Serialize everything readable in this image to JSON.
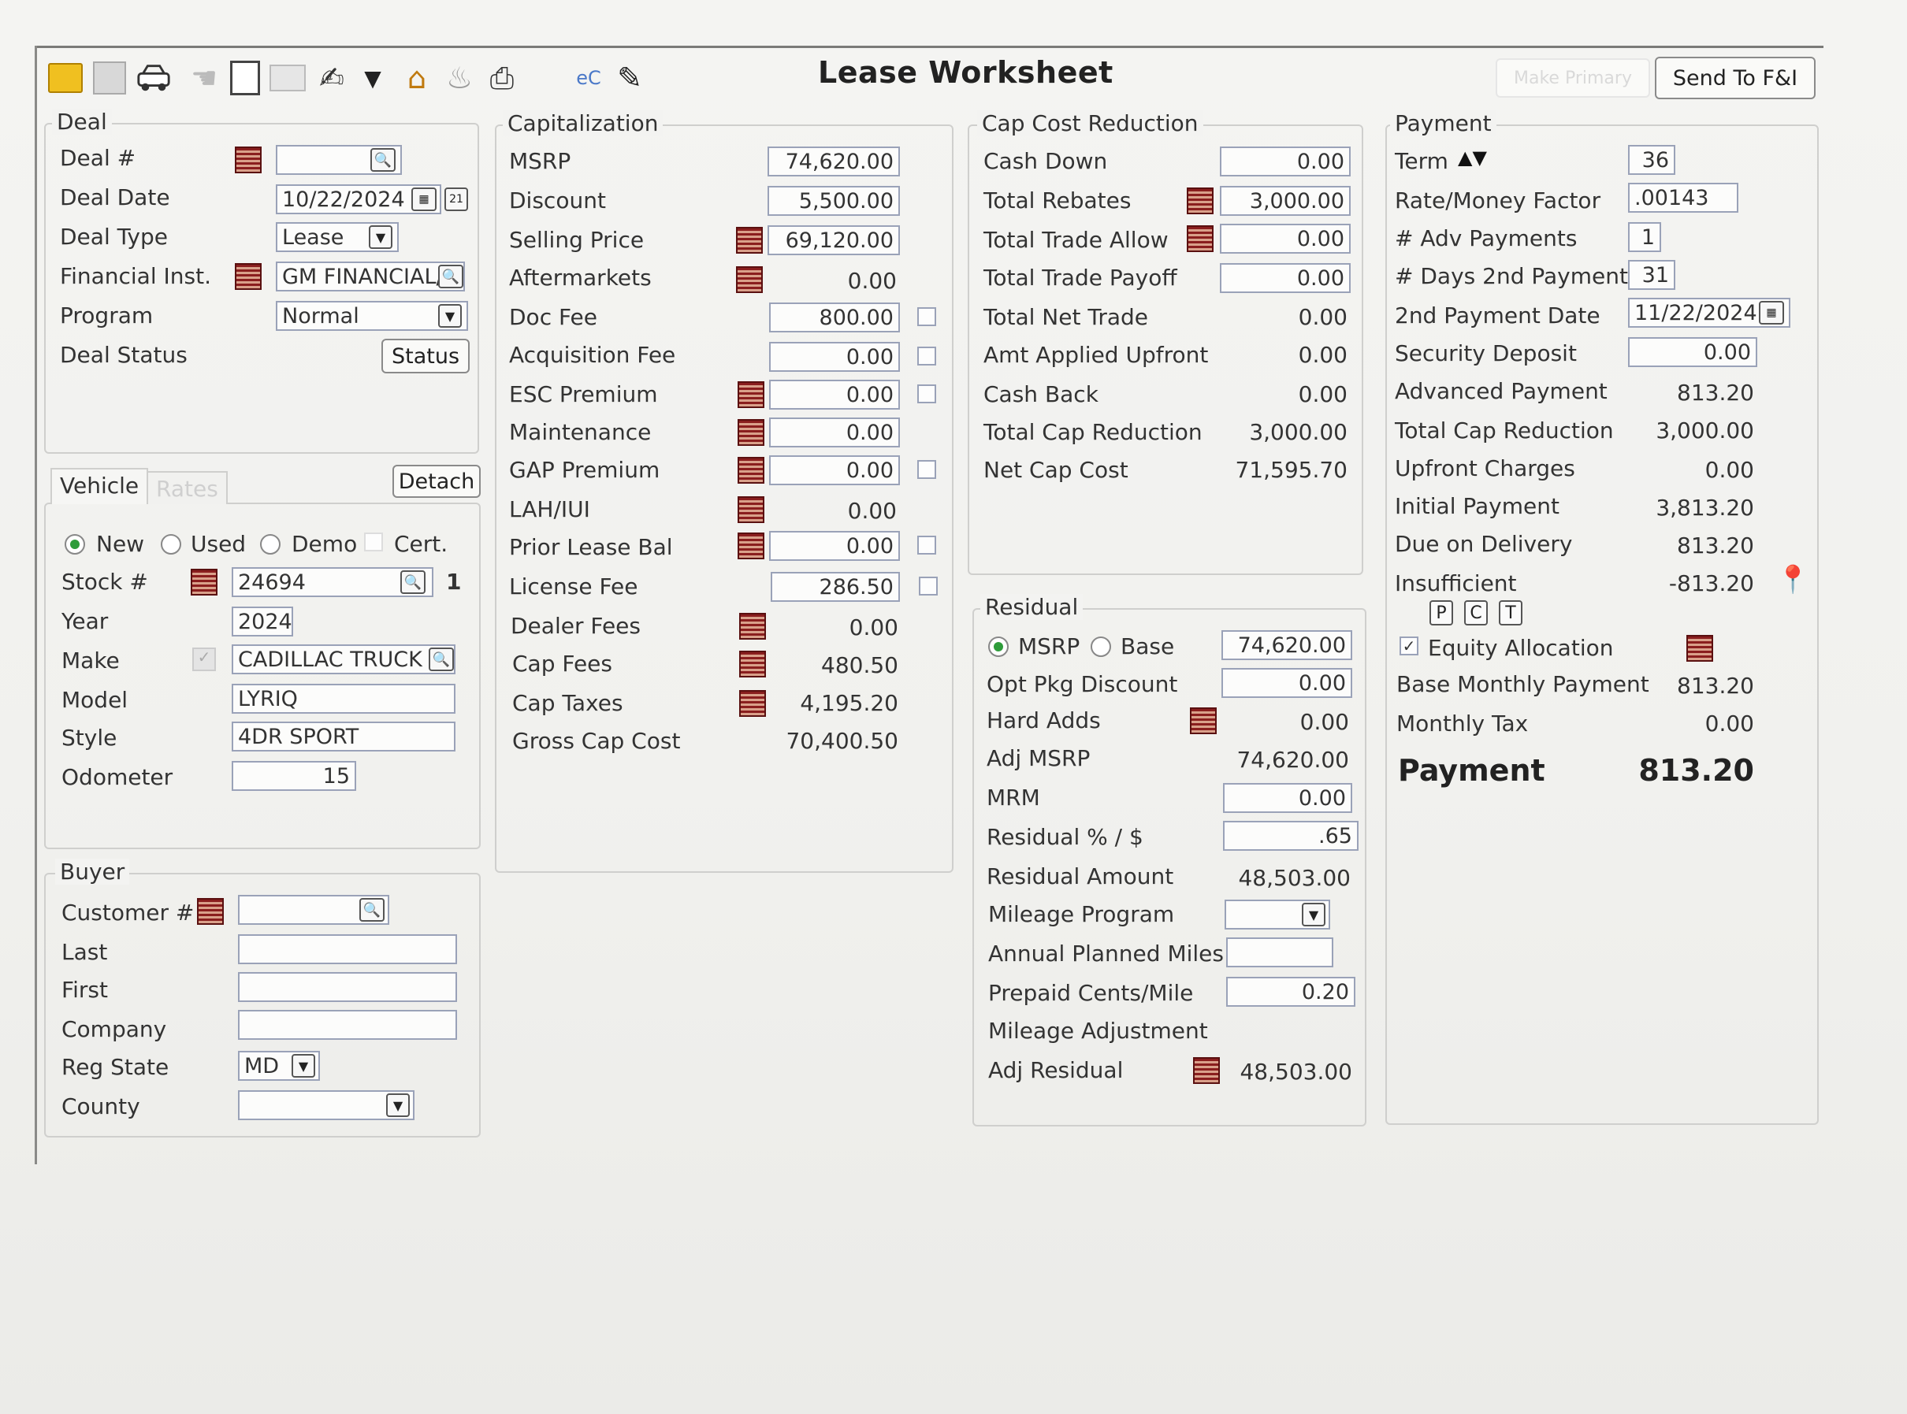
{
  "window": {
    "title": "Lease Worksheet",
    "make_primary_label": "Make Primary",
    "send_label": "Send To F&I"
  },
  "toolbar": {
    "icons": [
      "note-icon",
      "calculator-icon",
      "car-icon",
      "hand-icon",
      "document-icon",
      "keyboard-icon",
      "pen-icon",
      "house-icon",
      "fire-icon",
      "printer-icon",
      "ec-icon",
      "edit-icon"
    ],
    "ec_text": "eC"
  },
  "deal": {
    "title": "Deal",
    "deal_no_label": "Deal #",
    "deal_no": "",
    "deal_date_label": "Deal Date",
    "deal_date": "10/22/2024",
    "deal_type_label": "Deal Type",
    "deal_type": "Lease",
    "fin_inst_label": "Financial Inst.",
    "fin_inst": "GM FINANCIAL/",
    "program_label": "Program",
    "program": "Normal",
    "status_label": "Deal Status",
    "status_button": "Status"
  },
  "vehicle": {
    "tab_vehicle": "Vehicle",
    "tab_rates": "Rates",
    "detach": "Detach",
    "new": "New",
    "used": "Used",
    "demo": "Demo",
    "cert": "Cert.",
    "stock_label": "Stock #",
    "stock": "24694",
    "stock_count": "1",
    "year_label": "Year",
    "year": "2024",
    "make_label": "Make",
    "make": "CADILLAC TRUCK",
    "model_label": "Model",
    "model": "LYRIQ",
    "style_label": "Style",
    "style": "4DR SPORT",
    "odometer_label": "Odometer",
    "odometer": "15"
  },
  "buyer": {
    "title": "Buyer",
    "customer_label": "Customer #",
    "customer": "",
    "last_label": "Last",
    "last": "",
    "first_label": "First",
    "first": "",
    "company_label": "Company",
    "company": "",
    "reg_state_label": "Reg State",
    "reg_state": "MD",
    "county_label": "County",
    "county": ""
  },
  "capitalization": {
    "title": "Capitalization",
    "rows": [
      {
        "label": "MSRP",
        "value": "74,620.00"
      },
      {
        "label": "Discount",
        "value": "5,500.00"
      },
      {
        "label": "Selling Price",
        "value": "69,120.00"
      },
      {
        "label": "Aftermarkets",
        "value": "0.00"
      },
      {
        "label": "Doc Fee",
        "value": "800.00"
      },
      {
        "label": "Acquisition Fee",
        "value": "0.00"
      },
      {
        "label": "ESC Premium",
        "value": "0.00"
      },
      {
        "label": "Maintenance",
        "value": "0.00"
      },
      {
        "label": "GAP Premium",
        "value": "0.00"
      },
      {
        "label": "LAH/IUI",
        "value": "0.00"
      },
      {
        "label": "Prior Lease Bal",
        "value": "0.00"
      },
      {
        "label": "License Fee",
        "value": "286.50"
      },
      {
        "label": "Dealer Fees",
        "value": "0.00"
      },
      {
        "label": "Cap Fees",
        "value": "480.50"
      },
      {
        "label": "Cap Taxes",
        "value": "4,195.20"
      },
      {
        "label": "Gross Cap Cost",
        "value": "70,400.50"
      }
    ]
  },
  "cap_reduction": {
    "title": "Cap Cost Reduction",
    "rows": [
      {
        "label": "Cash Down",
        "value": "0.00"
      },
      {
        "label": "Total Rebates",
        "value": "3,000.00"
      },
      {
        "label": "Total Trade Allow",
        "value": "0.00"
      },
      {
        "label": "Total Trade Payoff",
        "value": "0.00"
      },
      {
        "label": "Total Net Trade",
        "value": "0.00"
      },
      {
        "label": "Amt Applied Upfront",
        "value": "0.00"
      },
      {
        "label": "Cash Back",
        "value": "0.00"
      },
      {
        "label": "Total Cap Reduction",
        "value": "3,000.00"
      },
      {
        "label": "Net Cap Cost",
        "value": "71,595.70"
      }
    ]
  },
  "residual": {
    "title": "Residual",
    "msrp_radio": "MSRP",
    "base_radio": "Base",
    "base_value": "74,620.00",
    "rows": [
      {
        "label": "Opt Pkg Discount",
        "value": "0.00"
      },
      {
        "label": "Hard Adds",
        "value": "0.00"
      },
      {
        "label": "Adj MSRP",
        "value": "74,620.00"
      },
      {
        "label": "MRM",
        "value": "0.00"
      },
      {
        "label": "Residual % / $",
        "value": ".65"
      },
      {
        "label": "Residual Amount",
        "value": "48,503.00"
      },
      {
        "label": "Mileage Program",
        "value": ""
      },
      {
        "label": "Annual Planned Miles",
        "value": ""
      },
      {
        "label": "Prepaid Cents/Mile",
        "value": "0.20"
      },
      {
        "label": "Mileage Adjustment",
        "value": ""
      },
      {
        "label": "Adj Residual",
        "value": "48,503.00"
      }
    ]
  },
  "payment": {
    "title": "Payment",
    "rows": [
      {
        "label": "Term",
        "value": "36"
      },
      {
        "label": "Rate/Money Factor",
        "value": ".00143"
      },
      {
        "label": "# Adv Payments",
        "value": "1"
      },
      {
        "label": "# Days 2nd Payment",
        "value": "31"
      },
      {
        "label": "2nd Payment Date",
        "value": "11/22/2024"
      },
      {
        "label": "Security Deposit",
        "value": "0.00"
      },
      {
        "label": "Advanced Payment",
        "value": "813.20"
      },
      {
        "label": "Total Cap Reduction",
        "value": "3,000.00"
      },
      {
        "label": "Upfront Charges",
        "value": "0.00"
      },
      {
        "label": "Initial Payment",
        "value": "3,813.20"
      },
      {
        "label": "Due on Delivery",
        "value": "813.20"
      },
      {
        "label": "Insufficient",
        "value": "-813.20"
      }
    ],
    "pct": [
      "P",
      "C",
      "T"
    ],
    "equity_label": "Equity Allocation",
    "base_monthly_label": "Base Monthly Payment",
    "base_monthly": "813.20",
    "monthly_tax_label": "Monthly Tax",
    "monthly_tax": "0.00",
    "payment_label": "Payment",
    "payment": "813.20"
  }
}
